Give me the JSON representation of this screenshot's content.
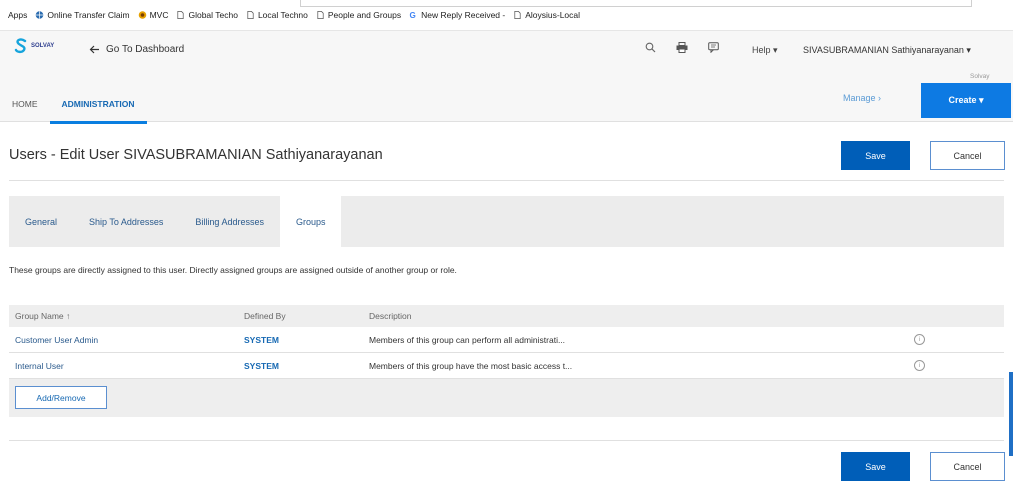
{
  "bookmarks": [
    {
      "label": "Apps",
      "icon": "apps-icon"
    },
    {
      "label": "Online Transfer Claim",
      "icon": "globe-icon"
    },
    {
      "label": "MVC",
      "icon": "mvc-icon"
    },
    {
      "label": "Global Techo",
      "icon": "page-icon"
    },
    {
      "label": "Local Techno",
      "icon": "page-icon"
    },
    {
      "label": "People and Groups",
      "icon": "page-icon"
    },
    {
      "label": "New Reply Received -",
      "icon": "google-icon"
    },
    {
      "label": "Aloysius-Local",
      "icon": "page-icon"
    }
  ],
  "header": {
    "logo_text": "SOLVAY",
    "goto_dashboard": "Go To Dashboard",
    "help": "Help ▾",
    "username": "SIVASUBRAMANIAN Sathiyanarayanan ▾",
    "tenant": "Solvay",
    "tabs": [
      "HOME",
      "ADMINISTRATION"
    ],
    "manage": "Manage ›",
    "create": "Create ▾"
  },
  "page": {
    "title": "Users - Edit User SIVASUBRAMANIAN Sathiyanarayanan",
    "save": "Save",
    "cancel": "Cancel"
  },
  "subtabs": [
    "General",
    "Ship To Addresses",
    "Billing Addresses",
    "Groups"
  ],
  "info_text": "These groups are directly assigned to this user. Directly assigned groups are assigned outside of another group or role.",
  "table": {
    "headers": [
      "Group Name ↑",
      "Defined By",
      "Description"
    ],
    "rows": [
      {
        "name": "Customer User Admin",
        "defined_by": "SYSTEM",
        "description": "Members of this group can perform all administrati..."
      },
      {
        "name": "Internal User",
        "defined_by": "SYSTEM",
        "description": "Members of this group have the most basic access t..."
      }
    ],
    "add_remove": "Add/Remove"
  },
  "colors": {
    "primary": "#005eb8",
    "create": "#0d7ae3",
    "link": "#2a5a8c"
  }
}
